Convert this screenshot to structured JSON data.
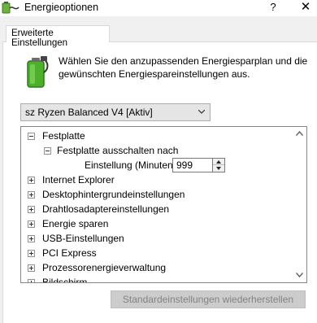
{
  "window": {
    "title": "Energieoptionen",
    "help_label": "?",
    "close_label": "✕"
  },
  "tab": {
    "label": "Erweiterte Einstellungen"
  },
  "description": {
    "line1": "Wählen Sie den anzupassenden Energiesparplan und die",
    "line2": "gewünschten Energiespareinstellungen aus."
  },
  "plan_select": {
    "value": "sz Ryzen Balanced V4 [Aktiv]"
  },
  "tree": {
    "items": [
      {
        "label": "Festplatte",
        "state": "expanded"
      },
      {
        "label": "Festplatte ausschalten nach",
        "state": "expanded"
      },
      {
        "label": "Einstellung (Minuten):"
      },
      {
        "label": "Internet Explorer",
        "state": "collapsed"
      },
      {
        "label": "Desktophintergrundeinstellungen",
        "state": "collapsed"
      },
      {
        "label": "Drahtlosadaptereinstellungen",
        "state": "collapsed"
      },
      {
        "label": "Energie sparen",
        "state": "collapsed"
      },
      {
        "label": "USB-Einstellungen",
        "state": "collapsed"
      },
      {
        "label": "PCI Express",
        "state": "collapsed"
      },
      {
        "label": "Prozessorenergieverwaltung",
        "state": "collapsed"
      },
      {
        "label": "Bildschirm",
        "state": "collapsed"
      }
    ],
    "setting_value": "999"
  },
  "buttons": {
    "restore": "Standardeinstellungen wiederherstellen"
  }
}
